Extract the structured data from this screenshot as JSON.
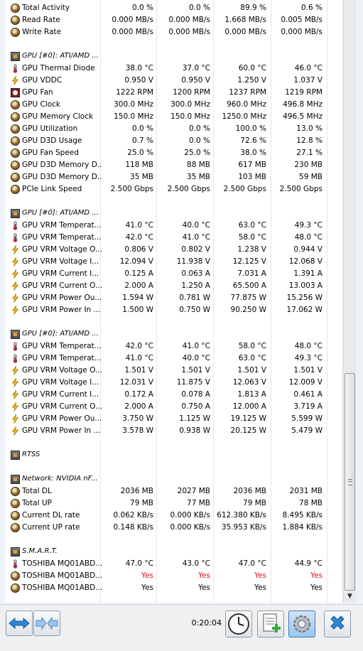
{
  "toolbar": {
    "timer": "0:20:04"
  },
  "rows": [
    {
      "type": "sensor",
      "icon": "disc",
      "name": "Total Activity",
      "v": [
        "0.0 %",
        "0.0 %",
        "89.9 %",
        "0.6 %"
      ]
    },
    {
      "type": "sensor",
      "icon": "disc",
      "name": "Read Rate",
      "v": [
        "0.000 MB/s",
        "0.000 MB/s",
        "1.668 MB/s",
        "0.005 MB/s"
      ]
    },
    {
      "type": "sensor",
      "icon": "disc",
      "name": "Write Rate",
      "v": [
        "0.000 MB/s",
        "0.000 MB/s",
        "0.000 MB/s",
        "0.000 MB/s"
      ]
    },
    {
      "type": "blank"
    },
    {
      "type": "header",
      "icon": "chip",
      "name": "GPU [#0]: ATI/AMD ..."
    },
    {
      "type": "sensor",
      "icon": "thermo",
      "name": "GPU Thermal Diode",
      "v": [
        "38.0 °C",
        "37.0 °C",
        "60.0 °C",
        "46.0 °C"
      ]
    },
    {
      "type": "sensor",
      "icon": "bolt",
      "name": "GPU VDDC",
      "v": [
        "0.950 V",
        "0.950 V",
        "1.250 V",
        "1.037 V"
      ]
    },
    {
      "type": "sensor",
      "icon": "fan",
      "name": "GPU Fan",
      "v": [
        "1222 RPM",
        "1200 RPM",
        "1237 RPM",
        "1219 RPM"
      ]
    },
    {
      "type": "sensor",
      "icon": "disc",
      "name": "GPU Clock",
      "v": [
        "300.0 MHz",
        "300.0 MHz",
        "960.0 MHz",
        "496.8 MHz"
      ]
    },
    {
      "type": "sensor",
      "icon": "disc",
      "name": "GPU Memory Clock",
      "v": [
        "150.0 MHz",
        "150.0 MHz",
        "1250.0 MHz",
        "496.5 MHz"
      ]
    },
    {
      "type": "sensor",
      "icon": "disc",
      "name": "GPU Utilization",
      "v": [
        "0.0 %",
        "0.0 %",
        "100.0 %",
        "13.0 %"
      ]
    },
    {
      "type": "sensor",
      "icon": "disc",
      "name": "GPU D3D Usage",
      "v": [
        "0.7 %",
        "0.0 %",
        "72.6 %",
        "12.8 %"
      ]
    },
    {
      "type": "sensor",
      "icon": "disc",
      "name": "GPU Fan Speed",
      "v": [
        "25.0 %",
        "25.0 %",
        "38.0 %",
        "27.1 %"
      ]
    },
    {
      "type": "sensor",
      "icon": "disc",
      "name": "GPU D3D Memory D...",
      "v": [
        "118 MB",
        "88 MB",
        "617 MB",
        "230 MB"
      ]
    },
    {
      "type": "sensor",
      "icon": "disc",
      "name": "GPU D3D Memory D...",
      "v": [
        "35 MB",
        "35 MB",
        "103 MB",
        "59 MB"
      ]
    },
    {
      "type": "sensor",
      "icon": "disc",
      "name": "PCIe Link Speed",
      "v": [
        "2.500 Gbps",
        "2.500 Gbps",
        "2.500 Gbps",
        "2.500 Gbps"
      ]
    },
    {
      "type": "blank"
    },
    {
      "type": "header",
      "icon": "chip",
      "name": "GPU [#0]: ATI/AMD ..."
    },
    {
      "type": "sensor",
      "icon": "thermo",
      "name": "GPU VRM Temperat...",
      "v": [
        "41.0 °C",
        "40.0 °C",
        "63.0 °C",
        "49.3 °C"
      ]
    },
    {
      "type": "sensor",
      "icon": "thermo",
      "name": "GPU VRM Temperat...",
      "v": [
        "42.0 °C",
        "41.0 °C",
        "58.0 °C",
        "48.0 °C"
      ]
    },
    {
      "type": "sensor",
      "icon": "bolt",
      "name": "GPU VRM Voltage O...",
      "v": [
        "0.806 V",
        "0.802 V",
        "1.238 V",
        "0.944 V"
      ]
    },
    {
      "type": "sensor",
      "icon": "bolt",
      "name": "GPU VRM Voltage I...",
      "v": [
        "12.094 V",
        "11.938 V",
        "12.125 V",
        "12.068 V"
      ]
    },
    {
      "type": "sensor",
      "icon": "bolt",
      "name": "GPU VRM Current I...",
      "v": [
        "0.125 A",
        "0.063 A",
        "7.031 A",
        "1.391 A"
      ]
    },
    {
      "type": "sensor",
      "icon": "bolt",
      "name": "GPU VRM Current O...",
      "v": [
        "2.000 A",
        "1.250 A",
        "65.500 A",
        "13.003 A"
      ]
    },
    {
      "type": "sensor",
      "icon": "bolt",
      "name": "GPU VRM Power Ou...",
      "v": [
        "1.594 W",
        "0.781 W",
        "77.875 W",
        "15.256 W"
      ]
    },
    {
      "type": "sensor",
      "icon": "bolt",
      "name": "GPU VRM Power In ...",
      "v": [
        "1.500 W",
        "0.750 W",
        "90.250 W",
        "17.062 W"
      ]
    },
    {
      "type": "blank"
    },
    {
      "type": "header",
      "icon": "chip",
      "name": "GPU [#0]: ATI/AMD ..."
    },
    {
      "type": "sensor",
      "icon": "thermo",
      "name": "GPU VRM Temperat...",
      "v": [
        "42.0 °C",
        "41.0 °C",
        "58.0 °C",
        "48.0 °C"
      ]
    },
    {
      "type": "sensor",
      "icon": "thermo",
      "name": "GPU VRM Temperat...",
      "v": [
        "41.0 °C",
        "40.0 °C",
        "63.0 °C",
        "49.3 °C"
      ]
    },
    {
      "type": "sensor",
      "icon": "bolt",
      "name": "GPU VRM Voltage O...",
      "v": [
        "1.501 V",
        "1.501 V",
        "1.501 V",
        "1.501 V"
      ]
    },
    {
      "type": "sensor",
      "icon": "bolt",
      "name": "GPU VRM Voltage I...",
      "v": [
        "12.031 V",
        "11.875 V",
        "12.063 V",
        "12.009 V"
      ]
    },
    {
      "type": "sensor",
      "icon": "bolt",
      "name": "GPU VRM Current I...",
      "v": [
        "0.172 A",
        "0.078 A",
        "1.813 A",
        "0.461 A"
      ]
    },
    {
      "type": "sensor",
      "icon": "bolt",
      "name": "GPU VRM Current O...",
      "v": [
        "2.000 A",
        "0.750 A",
        "12.000 A",
        "3.719 A"
      ]
    },
    {
      "type": "sensor",
      "icon": "bolt",
      "name": "GPU VRM Power Ou...",
      "v": [
        "3.750 W",
        "1.125 W",
        "19.125 W",
        "5.599 W"
      ]
    },
    {
      "type": "sensor",
      "icon": "bolt",
      "name": "GPU VRM Power In ...",
      "v": [
        "3.578 W",
        "0.938 W",
        "20.125 W",
        "5.479 W"
      ]
    },
    {
      "type": "blank"
    },
    {
      "type": "header",
      "icon": "chip",
      "name": "RTSS"
    },
    {
      "type": "blank"
    },
    {
      "type": "header",
      "icon": "chip",
      "name": "Network: NVIDIA nF..."
    },
    {
      "type": "sensor",
      "icon": "disc",
      "name": "Total DL",
      "v": [
        "2036 MB",
        "2027 MB",
        "2036 MB",
        "2031 MB"
      ]
    },
    {
      "type": "sensor",
      "icon": "disc",
      "name": "Total UP",
      "v": [
        "79 MB",
        "77 MB",
        "79 MB",
        "78 MB"
      ]
    },
    {
      "type": "sensor",
      "icon": "disc",
      "name": "Current DL rate",
      "v": [
        "0.062 KB/s",
        "0.000 KB/s",
        "612.380 KB/s",
        "8.495 KB/s"
      ]
    },
    {
      "type": "sensor",
      "icon": "disc",
      "name": "Current UP rate",
      "v": [
        "0.148 KB/s",
        "0.000 KB/s",
        "35.953 KB/s",
        "1.884 KB/s"
      ]
    },
    {
      "type": "blank"
    },
    {
      "type": "header",
      "icon": "chip",
      "name": "S.M.A.R.T."
    },
    {
      "type": "sensor",
      "icon": "thermo",
      "name": "TOSHIBA MQ01ABD...",
      "v": [
        "47.0 °C",
        "43.0 °C",
        "47.0 °C",
        "44.9 °C"
      ]
    },
    {
      "type": "sensor",
      "icon": "disc",
      "name": "TOSHIBA MQ01ABD...",
      "v": [
        "Yes",
        "Yes",
        "Yes",
        "Yes"
      ],
      "red": true
    },
    {
      "type": "sensor",
      "icon": "disc",
      "name": "TOSHIBA MQ01ABD...",
      "v": [
        "Yes",
        "Yes",
        "Yes",
        "Yes"
      ]
    }
  ]
}
